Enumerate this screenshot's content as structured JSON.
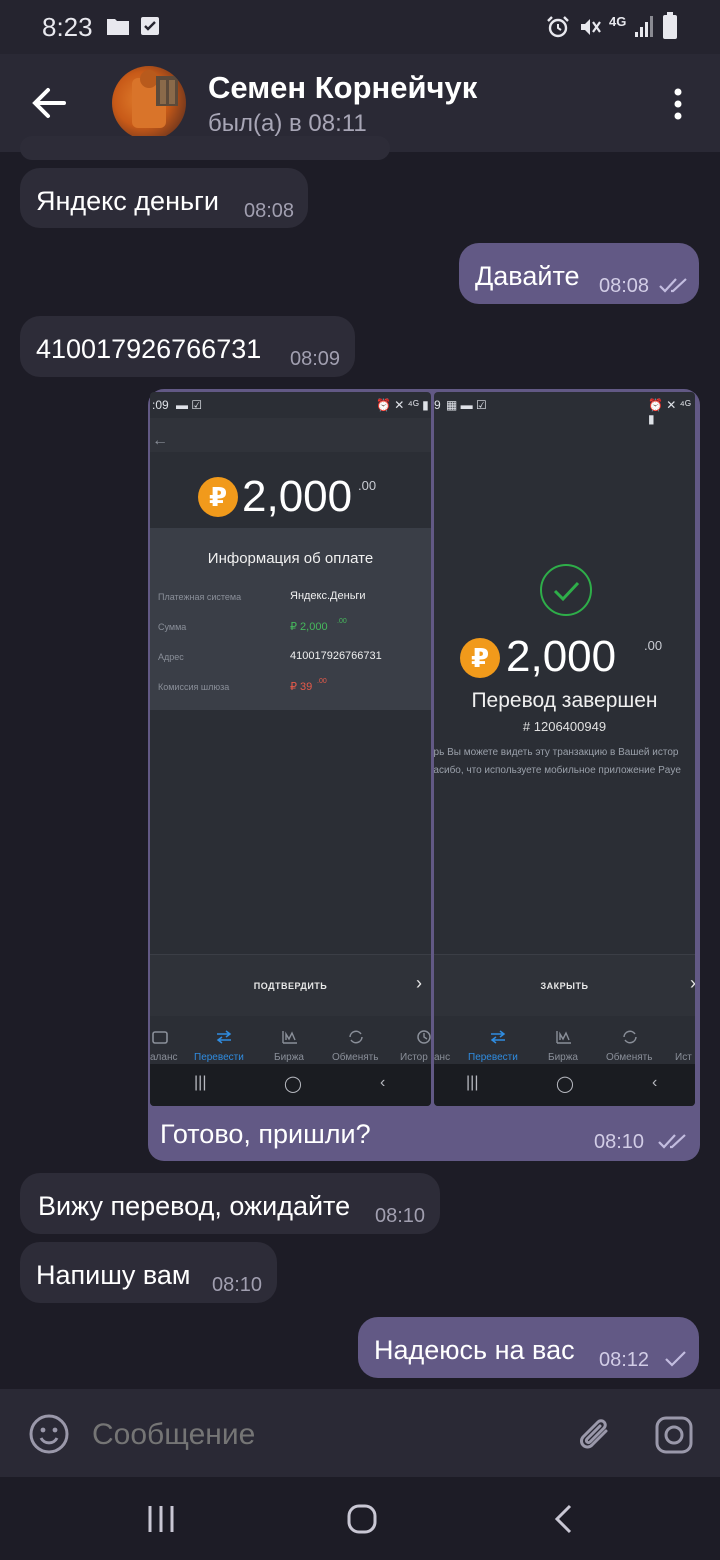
{
  "status_bar": {
    "time": "8:23",
    "network": "4G"
  },
  "header": {
    "contact_name": "Семен Корнейчук",
    "contact_status": "был(а) в 08:11"
  },
  "messages": [
    {
      "direction": "in",
      "text": "Яндекс деньги",
      "time": "08:08"
    },
    {
      "direction": "out",
      "text": "Давайте",
      "time": "08:08",
      "read": true
    },
    {
      "direction": "in",
      "text": "410017926766731",
      "time": "08:09"
    },
    {
      "direction": "in",
      "text": "Вижу перевод, ожидайте",
      "time": "08:10"
    },
    {
      "direction": "in",
      "text": "Напишу вам",
      "time": "08:10"
    },
    {
      "direction": "out",
      "text": "Надеюсь на вас",
      "time": "08:12",
      "read": false
    }
  ],
  "photo_message": {
    "caption": "Готово, пришли?",
    "time": "08:10",
    "read": true,
    "left_screenshot": {
      "status_time": ":09",
      "currency_symbol": "₽",
      "amount": "2,000",
      "decimals": ".00",
      "info_title": "Информация об оплате",
      "rows": [
        {
          "label": "Платежная система",
          "value": "Яндекс.Деньги"
        },
        {
          "label": "Сумма",
          "value": "₽ 2,000",
          "value_decimals": ".00"
        },
        {
          "label": "Адрес",
          "value": "410017926766731"
        },
        {
          "label": "Комиссия шлюза",
          "value": "₽ 39",
          "value_decimals": ".00"
        }
      ],
      "button_label": "ПОДТВЕРДИТЬ",
      "nav": [
        "аланс",
        "Перевести",
        "Биржа",
        "Обменять",
        "Истор"
      ]
    },
    "right_screenshot": {
      "status_time": "9",
      "currency_symbol": "₽",
      "amount": "2,000",
      "decimals": ".00",
      "title": "Перевод завершен",
      "transaction_number": "# 1206400949",
      "text_line1": "ерь Вы можете видеть эту транзакцию в Вашей истор",
      "text_line2": "пасибо, что используете мобильное приложение Paye",
      "button_label": "ЗАКРЫТЬ",
      "nav": [
        "анс",
        "Перевести",
        "Биржа",
        "Обменять",
        "Ист"
      ]
    }
  },
  "input": {
    "placeholder": "Сообщение"
  },
  "colors": {
    "bg": "#1d1c26",
    "incoming": "#2d2c38",
    "outgoing": "#625985",
    "accent": "#f19a1b",
    "success": "#2eae49"
  }
}
